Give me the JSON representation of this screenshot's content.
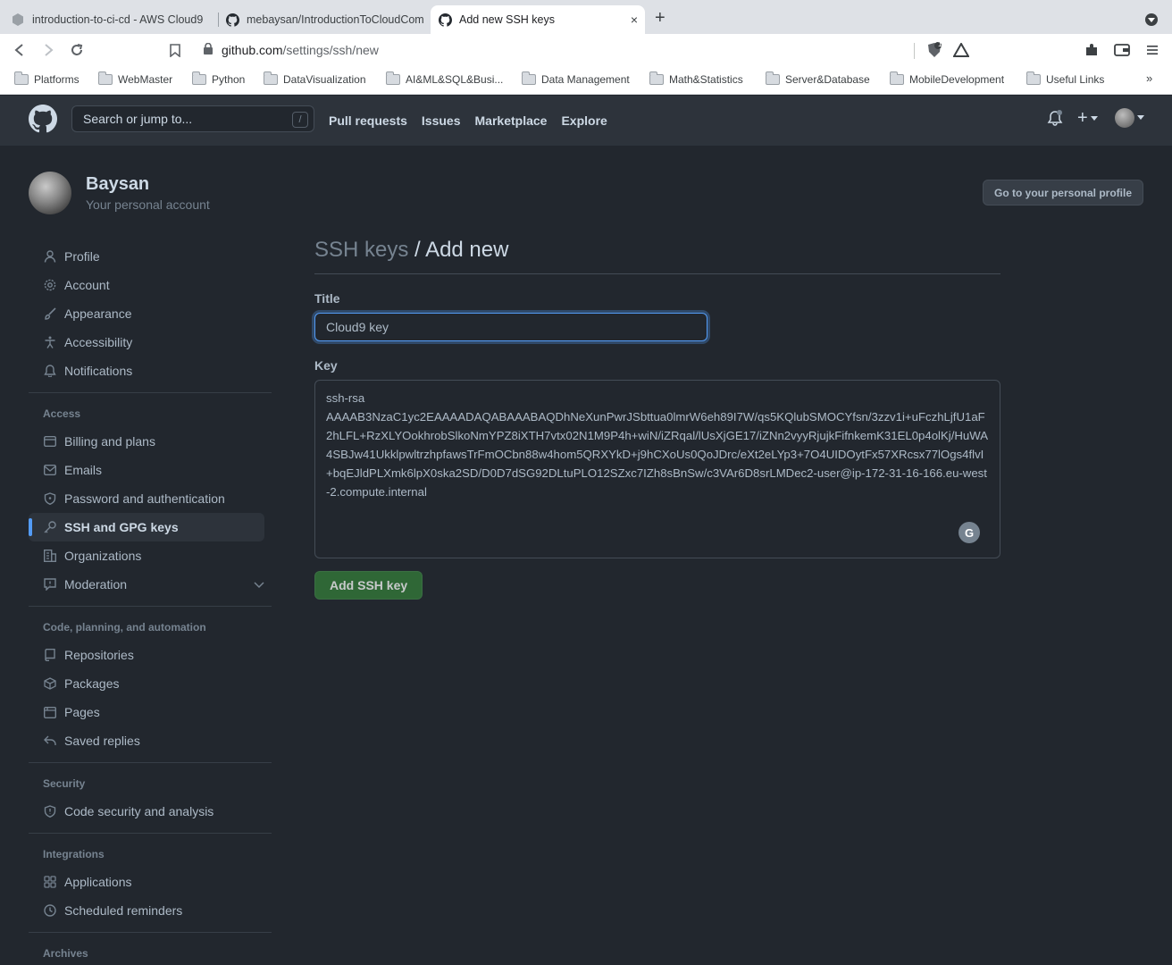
{
  "browser": {
    "tabs": [
      {
        "title": "introduction-to-ci-cd - AWS Cloud9",
        "active": false
      },
      {
        "title": "mebaysan/IntroductionToCloudCom",
        "active": false
      },
      {
        "title": "Add new SSH keys",
        "active": true
      }
    ],
    "new_tab_glyph": "+",
    "close_glyph": "×",
    "url_host": "github.com",
    "url_path": "/settings/ssh/new",
    "shield_count": "1",
    "bookmarks": [
      "Platforms",
      "WebMaster",
      "Python",
      "DataVisualization",
      "AI&ML&SQL&Busi...",
      "Data Management",
      "Math&Statistics",
      "Server&Database",
      "MobileDevelopment",
      "Useful Links"
    ],
    "bookmarks_more": "»"
  },
  "header": {
    "search_placeholder": "Search or jump to...",
    "search_key": "/",
    "nav": [
      "Pull requests",
      "Issues",
      "Marketplace",
      "Explore"
    ],
    "plus_glyph": "+"
  },
  "account": {
    "name": "Baysan",
    "subtitle": "Your personal account",
    "profile_button": "Go to your personal profile"
  },
  "sidebar": {
    "items_top": [
      {
        "label": "Profile",
        "icon": "person-icon"
      },
      {
        "label": "Account",
        "icon": "gear-icon"
      },
      {
        "label": "Appearance",
        "icon": "paintbrush-icon"
      },
      {
        "label": "Accessibility",
        "icon": "accessibility-icon"
      },
      {
        "label": "Notifications",
        "icon": "bell-icon"
      }
    ],
    "access_heading": "Access",
    "items_access": [
      {
        "label": "Billing and plans",
        "icon": "credit-card-icon"
      },
      {
        "label": "Emails",
        "icon": "mail-icon"
      },
      {
        "label": "Password and authentication",
        "icon": "shield-lock-icon"
      },
      {
        "label": "SSH and GPG keys",
        "icon": "key-icon",
        "selected": true
      },
      {
        "label": "Organizations",
        "icon": "organization-icon"
      },
      {
        "label": "Moderation",
        "icon": "report-icon"
      }
    ],
    "code_heading": "Code, planning, and automation",
    "items_code": [
      {
        "label": "Repositories",
        "icon": "repo-icon"
      },
      {
        "label": "Packages",
        "icon": "package-icon"
      },
      {
        "label": "Pages",
        "icon": "browser-icon"
      },
      {
        "label": "Saved replies",
        "icon": "reply-icon"
      }
    ],
    "security_heading": "Security",
    "items_security": [
      {
        "label": "Code security and analysis",
        "icon": "shield-icon"
      }
    ],
    "integrations_heading": "Integrations",
    "items_integrations": [
      {
        "label": "Applications",
        "icon": "apps-icon"
      },
      {
        "label": "Scheduled reminders",
        "icon": "clock-icon"
      }
    ],
    "archives_heading": "Archives"
  },
  "main": {
    "breadcrumb_parent": "SSH keys",
    "breadcrumb_sep": " / ",
    "breadcrumb_current": "Add new",
    "title_label": "Title",
    "title_value": "Cloud9 key",
    "key_label": "Key",
    "key_value": "ssh-rsa\nAAAAB3NzaC1yc2EAAAADAQABAAABAQDhNeXunPwrJSbttua0lmrW6eh89I7W/qs5KQlubSMOCYfsn/3zzv1i+uFczhLjfU1aF2hLFL+RzXLYOokhrobSlkoNmYPZ8iXTH7vtx02N1M9P4h+wiN/iZRqal/lUsXjGE17/iZNn2vyyRjujkFifnkemK31EL0p4olKj/HuWA4SBJw41UkklpwltrzhpfawsTrFmOCbn88w4hom5QRXYkD+j9hCXoUs0QoJDrc/eXt2eLYp3+7O4UIDOytFx57XRcsx77lOgs4flvI+bqEJldPLXmk6lpX0ska2SD/D0D7dSG92DLtuPLO12SZxc7IZh8sBnSw/c3VAr6D8srLMDec2-user@ip-172-31-16-166.eu-west-2.compute.internal",
    "grammarly_glyph": "G",
    "submit_label": "Add SSH key"
  }
}
